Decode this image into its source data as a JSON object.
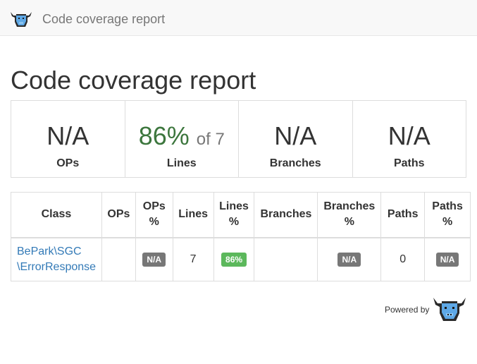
{
  "navbar": {
    "brand": "Code coverage report",
    "logo_icon": "bull-logo-icon"
  },
  "page_title": "Code coverage report",
  "summary": [
    {
      "value": "N/A",
      "label": "OPs"
    },
    {
      "value": "86%",
      "of": "of 7",
      "label": "Lines"
    },
    {
      "value": "N/A",
      "label": "Branches"
    },
    {
      "value": "N/A",
      "label": "Paths"
    }
  ],
  "table": {
    "headers": {
      "class": "Class",
      "ops": "OPs",
      "ops_pct_line1": "OPs",
      "ops_pct_line2": "%",
      "lines": "Lines",
      "lines_pct_line1": "Lines",
      "lines_pct_line2": "%",
      "branches": "Branches",
      "branches_pct_line1": "Branches",
      "branches_pct_line2": "%",
      "paths": "Paths",
      "paths_pct_line1": "Paths",
      "paths_pct_line2": "%"
    },
    "rows": [
      {
        "class_line1": "BePark\\SGC",
        "class_line2": "\\ErrorResponse",
        "ops": "",
        "ops_pct": "N/A",
        "lines": "7",
        "lines_pct": "86%",
        "branches": "",
        "branches_pct": "N/A",
        "paths": "0",
        "paths_pct": "N/A"
      }
    ]
  },
  "footer": {
    "powered_by": "Powered by",
    "logo_icon": "bull-logo-icon"
  },
  "colors": {
    "success": "#5cb85c",
    "default_badge": "#777777",
    "link": "#337ab7",
    "coverage_text": "#3c763d"
  }
}
